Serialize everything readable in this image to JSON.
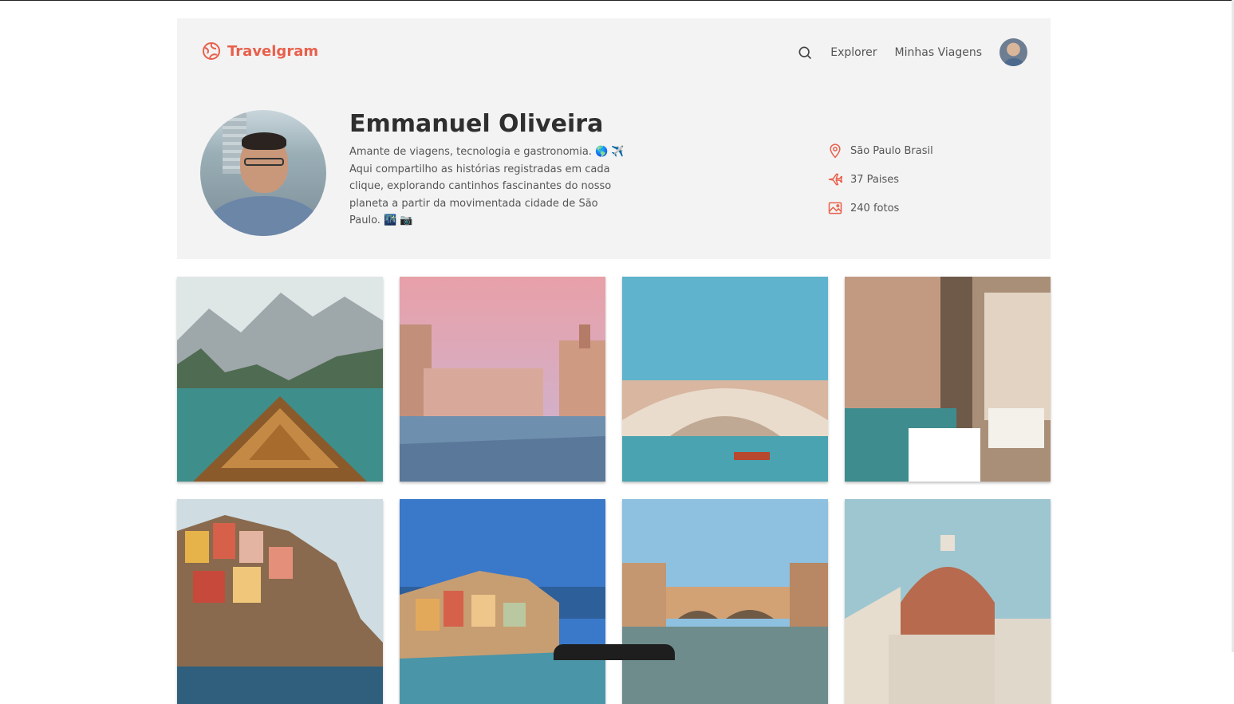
{
  "app": {
    "brand_name": "Travelgram",
    "accent_color": "#e8604c"
  },
  "nav": {
    "search_icon": "search-icon",
    "links": [
      {
        "label": "Explorer"
      },
      {
        "label": "Minhas Viagens"
      }
    ]
  },
  "profile": {
    "name": "Emmanuel Oliveira",
    "bio": "Amante de viagens, tecnologia e gastronomia. 🌎 ✈️ Aqui compartilho as histórias registradas em cada clique, explorando cantinhos fascinantes do nosso planeta a partir da movimentada cidade de São Paulo. 🌃 📷",
    "stats": [
      {
        "icon": "map-pin-icon",
        "label": "São Paulo Brasil"
      },
      {
        "icon": "airplane-icon",
        "label": "37 Paises"
      },
      {
        "icon": "image-icon",
        "label": "240 fotos"
      }
    ]
  },
  "gallery": {
    "photos": [
      {
        "subject": "lake-boat"
      },
      {
        "subject": "venice-canal"
      },
      {
        "subject": "rialto-bridge"
      },
      {
        "subject": "venice-restaurant"
      },
      {
        "subject": "cinque-terre-cliff"
      },
      {
        "subject": "vernazza-harbor"
      },
      {
        "subject": "ponte-vecchio"
      },
      {
        "subject": "florence-duomo"
      }
    ]
  }
}
